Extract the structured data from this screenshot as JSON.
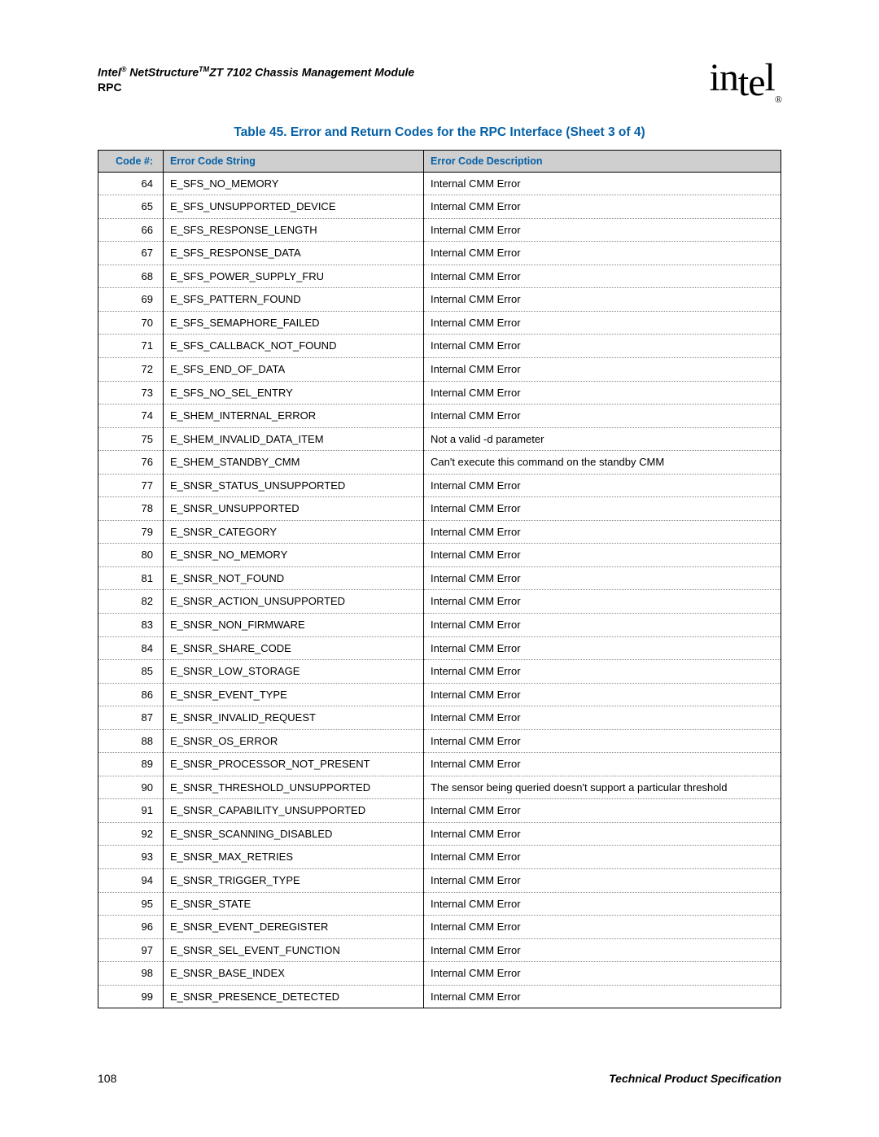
{
  "header": {
    "title_prefix": "Intel",
    "title_mid": " NetStructure",
    "title_suffix": "ZT 7102 Chassis Management Module",
    "subtitle": "RPC",
    "logo_text": "intel"
  },
  "table": {
    "caption": "Table 45.  Error and Return Codes for the RPC Interface (Sheet 3 of 4)",
    "headers": {
      "code": "Code #:",
      "string": "Error Code String",
      "description": "Error Code Description"
    },
    "rows": [
      {
        "code": "64",
        "string": "E_SFS_NO_MEMORY",
        "desc": "Internal CMM Error"
      },
      {
        "code": "65",
        "string": "E_SFS_UNSUPPORTED_DEVICE",
        "desc": "Internal CMM Error"
      },
      {
        "code": "66",
        "string": "E_SFS_RESPONSE_LENGTH",
        "desc": "Internal CMM Error"
      },
      {
        "code": "67",
        "string": "E_SFS_RESPONSE_DATA",
        "desc": "Internal CMM Error"
      },
      {
        "code": "68",
        "string": "E_SFS_POWER_SUPPLY_FRU",
        "desc": "Internal CMM Error"
      },
      {
        "code": "69",
        "string": "E_SFS_PATTERN_FOUND",
        "desc": "Internal CMM Error"
      },
      {
        "code": "70",
        "string": "E_SFS_SEMAPHORE_FAILED",
        "desc": "Internal CMM Error"
      },
      {
        "code": "71",
        "string": "E_SFS_CALLBACK_NOT_FOUND",
        "desc": "Internal CMM Error"
      },
      {
        "code": "72",
        "string": "E_SFS_END_OF_DATA",
        "desc": "Internal CMM Error"
      },
      {
        "code": "73",
        "string": "E_SFS_NO_SEL_ENTRY",
        "desc": "Internal CMM Error"
      },
      {
        "code": "74",
        "string": "E_SHEM_INTERNAL_ERROR",
        "desc": "Internal CMM Error"
      },
      {
        "code": "75",
        "string": "E_SHEM_INVALID_DATA_ITEM",
        "desc": "Not a valid -d parameter"
      },
      {
        "code": "76",
        "string": "E_SHEM_STANDBY_CMM",
        "desc": "Can't execute this command on the standby CMM"
      },
      {
        "code": "77",
        "string": "E_SNSR_STATUS_UNSUPPORTED",
        "desc": "Internal CMM Error"
      },
      {
        "code": "78",
        "string": "E_SNSR_UNSUPPORTED",
        "desc": "Internal CMM Error"
      },
      {
        "code": "79",
        "string": "E_SNSR_CATEGORY",
        "desc": "Internal CMM Error"
      },
      {
        "code": "80",
        "string": "E_SNSR_NO_MEMORY",
        "desc": "Internal CMM Error"
      },
      {
        "code": "81",
        "string": "E_SNSR_NOT_FOUND",
        "desc": "Internal CMM Error"
      },
      {
        "code": "82",
        "string": "E_SNSR_ACTION_UNSUPPORTED",
        "desc": "Internal CMM Error"
      },
      {
        "code": "83",
        "string": "E_SNSR_NON_FIRMWARE",
        "desc": "Internal CMM Error"
      },
      {
        "code": "84",
        "string": "E_SNSR_SHARE_CODE",
        "desc": "Internal CMM Error"
      },
      {
        "code": "85",
        "string": "E_SNSR_LOW_STORAGE",
        "desc": "Internal CMM Error"
      },
      {
        "code": "86",
        "string": "E_SNSR_EVENT_TYPE",
        "desc": "Internal CMM Error"
      },
      {
        "code": "87",
        "string": "E_SNSR_INVALID_REQUEST",
        "desc": "Internal CMM Error"
      },
      {
        "code": "88",
        "string": "E_SNSR_OS_ERROR",
        "desc": "Internal CMM Error"
      },
      {
        "code": "89",
        "string": "E_SNSR_PROCESSOR_NOT_PRESENT",
        "desc": "Internal CMM Error"
      },
      {
        "code": "90",
        "string": "E_SNSR_THRESHOLD_UNSUPPORTED",
        "desc": "The sensor being queried doesn't support a particular threshold"
      },
      {
        "code": "91",
        "string": "E_SNSR_CAPABILITY_UNSUPPORTED",
        "desc": "Internal CMM Error"
      },
      {
        "code": "92",
        "string": "E_SNSR_SCANNING_DISABLED",
        "desc": "Internal CMM Error"
      },
      {
        "code": "93",
        "string": "E_SNSR_MAX_RETRIES",
        "desc": "Internal CMM Error"
      },
      {
        "code": "94",
        "string": "E_SNSR_TRIGGER_TYPE",
        "desc": "Internal CMM Error"
      },
      {
        "code": "95",
        "string": "E_SNSR_STATE",
        "desc": "Internal CMM Error"
      },
      {
        "code": "96",
        "string": "E_SNSR_EVENT_DEREGISTER",
        "desc": "Internal CMM Error"
      },
      {
        "code": "97",
        "string": "E_SNSR_SEL_EVENT_FUNCTION",
        "desc": "Internal CMM Error"
      },
      {
        "code": "98",
        "string": "E_SNSR_BASE_INDEX",
        "desc": "Internal CMM Error"
      },
      {
        "code": "99",
        "string": "E_SNSR_PRESENCE_DETECTED",
        "desc": "Internal CMM Error"
      }
    ]
  },
  "footer": {
    "page": "108",
    "spec": "Technical Product Specification"
  }
}
